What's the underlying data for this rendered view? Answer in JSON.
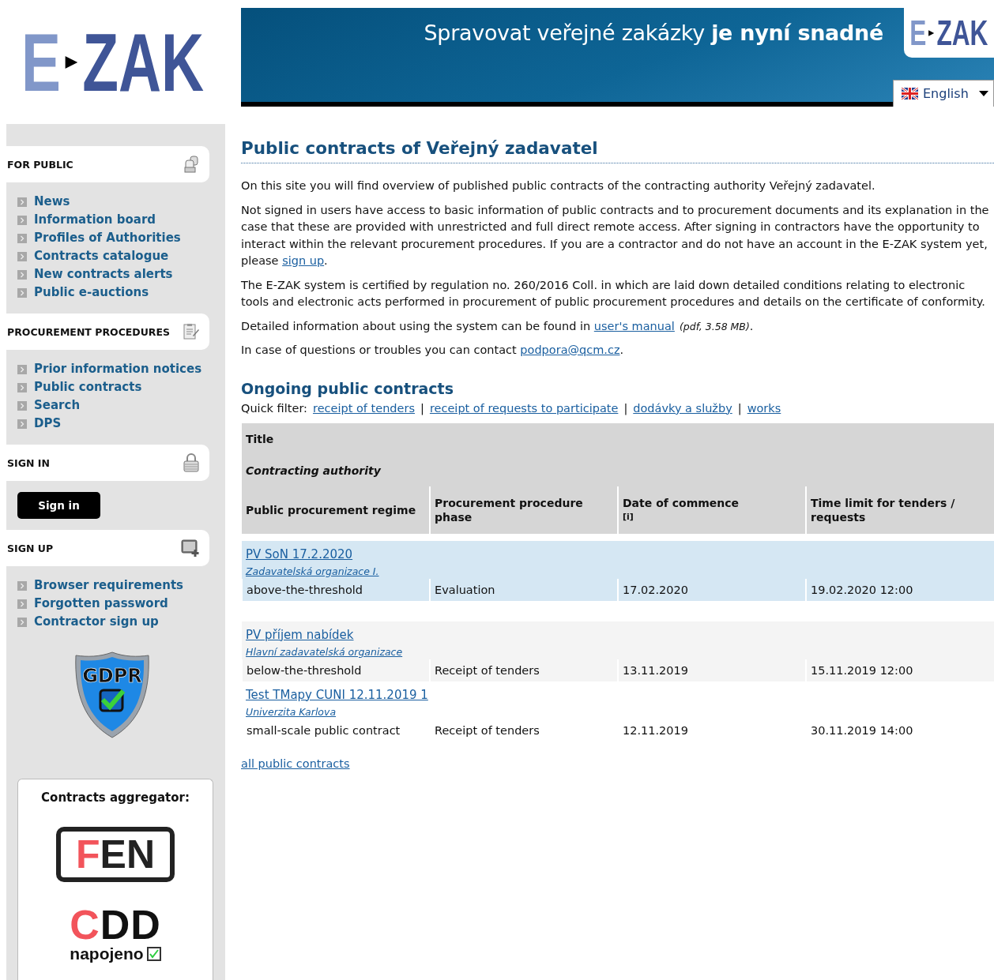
{
  "logo": {
    "left": "E",
    "right": "ZAK"
  },
  "banner": {
    "slogan": "Spravovat veřejné zakázky **je nyní snadné**",
    "logo": {
      "left": "E",
      "right": "ZAK"
    },
    "language": "English"
  },
  "sidebar": {
    "sections": [
      {
        "kind": "links",
        "title": "FOR PUBLIC",
        "items": [
          "News",
          "Information board",
          "Profiles of Authorities",
          "Contracts catalogue",
          "New contracts alerts",
          "Public e-auctions"
        ]
      },
      {
        "kind": "links",
        "title": "PROCUREMENT PROCEDURES",
        "items": [
          "Prior information notices",
          "Public contracts",
          "Search",
          "DPS"
        ]
      },
      {
        "kind": "button",
        "title": "SIGN IN",
        "button": "Sign in"
      },
      {
        "kind": "links",
        "title": "SIGN UP",
        "items": [
          "Browser requirements",
          "Forgotten password",
          "Contractor sign up"
        ]
      }
    ],
    "gdpr": "GDPR",
    "aggregator": {
      "title": "Contracts aggregator:",
      "fen": {
        "accent": "F",
        "rest": "EN"
      },
      "cdd": {
        "accent": "C",
        "rest": "DD",
        "caption": "napojeno"
      }
    }
  },
  "main": {
    "title": "Public contracts of Veřejný zadavatel",
    "paragraphs": [
      [
        {
          "kind": "text",
          "text": "On this site you will find overview of published public contracts of the contracting authority Veřejný zadavatel."
        }
      ],
      [
        {
          "kind": "text",
          "text": "Not signed in users have access to basic information of public contracts and to procurement documents and its explanation in the case that these are provided with unrestricted and full direct remote access. After signing in contractors have the opportunity to interact within the relevant procurement procedures. If you are a contractor and do not have an account in the E-ZAK system yet, please "
        },
        {
          "kind": "link",
          "text": "sign up"
        },
        {
          "kind": "text",
          "text": "."
        }
      ],
      [
        {
          "kind": "text",
          "text": "The E-ZAK system is certified by regulation no. 260/2016 Coll. in which are laid down detailed conditions relating to electronic tools and electronic acts performed in procurement of public procurement procedures and details on the certificate of conformity."
        }
      ],
      [
        {
          "kind": "text",
          "text": "Detailed information about using the system can be found in "
        },
        {
          "kind": "link",
          "text": "user's manual"
        },
        {
          "kind": "note",
          "text": "(pdf, 3.58 MB)"
        },
        {
          "kind": "text",
          "text": "."
        }
      ],
      [
        {
          "kind": "text",
          "text": "In case of questions or troubles you can contact "
        },
        {
          "kind": "link",
          "text": "podpora@qcm.cz"
        },
        {
          "kind": "text",
          "text": "."
        }
      ]
    ],
    "ongoing": {
      "title": "Ongoing public contracts",
      "quick_filter": {
        "label": "Quick filter:",
        "items": [
          {
            "text": "receipt of tenders"
          },
          {
            "separator": "|",
            "text": "receipt of requests to participate"
          },
          {
            "separator": "|",
            "text": "dodávky a služby"
          },
          {
            "separator": "|",
            "text": "works"
          }
        ]
      },
      "table": {
        "header_title": "Title",
        "header_authority": "Contracting authority",
        "columns": [
          {
            "label": "Public procurement regime"
          },
          {
            "label": "Procurement procedure phase"
          },
          {
            "label": "Date of commence",
            "note": "[i]"
          },
          {
            "label": "Time limit for tenders / requests"
          }
        ],
        "rows": [
          {
            "highlighted": true,
            "title": "PV SoN 17.2.2020",
            "authority": "Zadavatelská organizace I.",
            "cells": [
              "above-the-threshold",
              "Evaluation",
              "17.02.2020",
              "19.02.2020 12:00"
            ]
          },
          {
            "highlighted": false,
            "title": "PV příjem nabídek",
            "authority": "Hlavní zadavatelská organizace",
            "cells": [
              "below-the-threshold",
              "Receipt of tenders",
              "13.11.2019",
              "15.11.2019 12:00"
            ]
          },
          {
            "highlighted": false,
            "title": "Test TMapy CUNI 12.11.2019 1",
            "authority": "Univerzita Karlova",
            "cells": [
              "small-scale public contract",
              "Receipt of tenders",
              "12.11.2019",
              "30.11.2019 14:00"
            ]
          }
        ]
      },
      "all_link": "all public contracts"
    }
  }
}
